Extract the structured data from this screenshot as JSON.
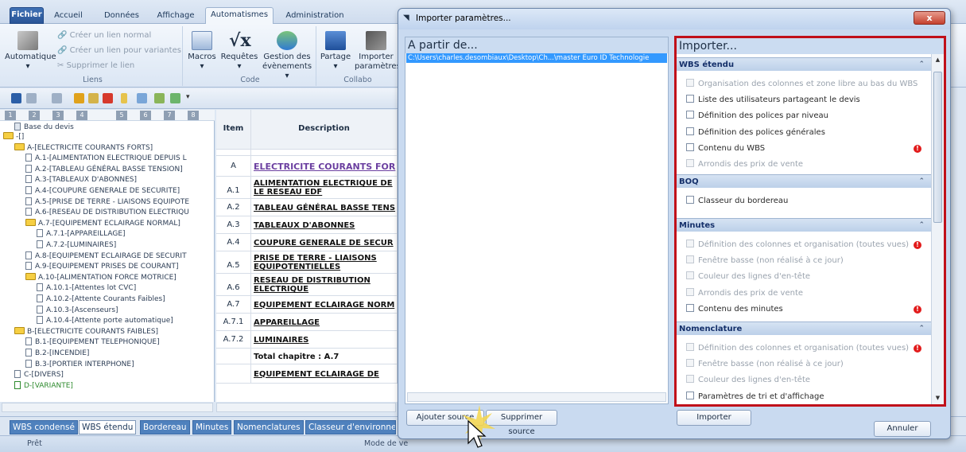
{
  "ribbon": {
    "tabs": [
      "Fichier",
      "Accueil",
      "Données",
      "Affichage",
      "Automatismes",
      "Administration"
    ],
    "active_tab": "Automatismes",
    "liens": {
      "label": "Liens",
      "automatique": "Automatique",
      "creer_normal": "Créer un lien normal",
      "creer_variantes": "Créer un lien pour variantes",
      "supprimer": "Supprimer le lien"
    },
    "code": {
      "label": "Code",
      "macros": "Macros",
      "requetes": "Requêtes",
      "gestion1": "Gestion des",
      "gestion2": "évènements"
    },
    "collab": {
      "label": "Collabo",
      "partage": "Partage",
      "importer1": "Importer",
      "importer2": "paramètres"
    }
  },
  "tree": {
    "levels": [
      "1",
      "2",
      "3",
      "4",
      "5",
      "6",
      "7",
      "8"
    ],
    "root": "Base du devis",
    "nodes": [
      {
        "text": "-[]",
        "indent": 0,
        "type": "folder"
      },
      {
        "text": "A-[ELECTRICITE COURANTS FORTS]",
        "indent": 1,
        "type": "folder"
      },
      {
        "text": "A.1-[ALIMENTATION ELECTRIQUE DEPUIS L",
        "indent": 2,
        "type": "doc"
      },
      {
        "text": "A.2-[TABLEAU GÉNÉRAL BASSE TENSION]",
        "indent": 2,
        "type": "doc"
      },
      {
        "text": "A.3-[TABLEAUX D'ABONNES]",
        "indent": 2,
        "type": "doc"
      },
      {
        "text": "A.4-[COUPURE GENERALE DE SECURITE]",
        "indent": 2,
        "type": "doc"
      },
      {
        "text": "A.5-[PRISE DE TERRE - LIAISONS EQUIPOTE",
        "indent": 2,
        "type": "doc"
      },
      {
        "text": "A.6-[RESEAU DE DISTRIBUTION ELECTRIQU",
        "indent": 2,
        "type": "doc"
      },
      {
        "text": "A.7-[EQUIPEMENT ECLAIRAGE NORMAL]",
        "indent": 2,
        "type": "folder"
      },
      {
        "text": "A.7.1-[APPAREILLAGE]",
        "indent": 3,
        "type": "doc"
      },
      {
        "text": "A.7.2-[LUMINAIRES]",
        "indent": 3,
        "type": "doc"
      },
      {
        "text": "A.8-[EQUIPEMENT ECLAIRAGE DE SECURIT",
        "indent": 2,
        "type": "doc"
      },
      {
        "text": "A.9-[EQUIPEMENT PRISES DE COURANT]",
        "indent": 2,
        "type": "doc"
      },
      {
        "text": "A.10-[ALIMENTATION FORCE MOTRICE]",
        "indent": 2,
        "type": "folder"
      },
      {
        "text": "A.10.1-[Attentes lot CVC]",
        "indent": 3,
        "type": "doc"
      },
      {
        "text": "A.10.2-[Attente Courants Faibles]",
        "indent": 3,
        "type": "doc"
      },
      {
        "text": "A.10.3-[Ascenseurs]",
        "indent": 3,
        "type": "doc"
      },
      {
        "text": "A.10.4-[Attente porte automatique]",
        "indent": 3,
        "type": "doc"
      },
      {
        "text": "B-[ELECTRICITE COURANTS FAIBLES]",
        "indent": 1,
        "type": "folder"
      },
      {
        "text": "B.1-[EQUIPEMENT TELEPHONIQUE]",
        "indent": 2,
        "type": "doc"
      },
      {
        "text": "B.2-[INCENDIE]",
        "indent": 2,
        "type": "doc"
      },
      {
        "text": "B.3-[PORTIER INTERPHONE]",
        "indent": 2,
        "type": "doc"
      },
      {
        "text": "C-[DIVERS]",
        "indent": 1,
        "type": "doc"
      },
      {
        "text": "D-[VARIANTE]",
        "indent": 1,
        "type": "variant"
      }
    ]
  },
  "grid": {
    "col_item": "Item",
    "col_desc": "Description",
    "rows": [
      {
        "item": "",
        "desc": ""
      },
      {
        "item": "A",
        "desc": "ELECTRICITE COURANTS FOR",
        "style": "purple"
      },
      {
        "item": "A.1",
        "desc": "ALIMENTATION ELECTRIQUE DE",
        "desc2": "LE RESEAU EDF"
      },
      {
        "item": "A.2",
        "desc": "TABLEAU GÉNÉRAL BASSE TENS"
      },
      {
        "item": "A.3",
        "desc": "TABLEAUX D'ABONNES"
      },
      {
        "item": "A.4",
        "desc": "COUPURE GENERALE DE SECUR"
      },
      {
        "item": "A.5",
        "desc": "PRISE DE TERRE - LIAISONS",
        "desc2": "EQUIPOTENTIELLES"
      },
      {
        "item": "A.6",
        "desc": "RESEAU DE DISTRIBUTION",
        "desc2": "ELECTRIQUE"
      },
      {
        "item": "A.7",
        "desc": "EQUIPEMENT ECLAIRAGE NORM"
      },
      {
        "item": "A.7.1",
        "desc": "APPAREILLAGE"
      },
      {
        "item": "A.7.2",
        "desc": "LUMINAIRES"
      },
      {
        "item": "",
        "desc": "Total chapitre : A.7",
        "style": "total"
      },
      {
        "item": "",
        "desc": "EQUIPEMENT ECLAIRAGE DE"
      }
    ]
  },
  "sheet_tabs": [
    "WBS condensé",
    "WBS étendu",
    "Bordereau",
    "Minutes",
    "Nomenclatures",
    "Classeur d'environne"
  ],
  "active_sheet_tab": "WBS étendu",
  "status": {
    "left": "Prêt",
    "mode": "Mode de ve"
  },
  "dialog": {
    "title": "Importer paramètres...",
    "close_label": "x",
    "from_header": "A partir de...",
    "source_path": "C:\\Users\\charles.desombiaux\\Desktop\\Ch...\\master Euro ID Technologie",
    "add_source": "Ajouter source",
    "remove_source": "Supprimer source",
    "import_header": "Importer...",
    "import_button": "Importer",
    "cancel_button": "Annuler",
    "sections": [
      {
        "title": "WBS étendu",
        "options": [
          {
            "label": "Organisation des colonnes et zone libre au bas du WBS",
            "enabled": false,
            "warn": false
          },
          {
            "label": "Liste des utilisateurs partageant le devis",
            "enabled": true,
            "warn": false
          },
          {
            "label": "Définition des polices par niveau",
            "enabled": true,
            "warn": false
          },
          {
            "label": "Définition des polices générales",
            "enabled": true,
            "warn": false
          },
          {
            "label": "Contenu du WBS",
            "enabled": true,
            "warn": true
          },
          {
            "label": "Arrondis des prix de vente",
            "enabled": false,
            "warn": false
          }
        ]
      },
      {
        "title": "BOQ",
        "options": [
          {
            "label": "Classeur du bordereau",
            "enabled": true,
            "warn": false
          }
        ]
      },
      {
        "title": "Minutes",
        "options": [
          {
            "label": "Définition des colonnes et organisation (toutes vues)",
            "enabled": false,
            "warn": true
          },
          {
            "label": "Fenêtre basse (non réalisé à ce jour)",
            "enabled": false,
            "warn": false
          },
          {
            "label": "Couleur des lignes d'en-tête",
            "enabled": false,
            "warn": false
          },
          {
            "label": "Arrondis des prix de vente",
            "enabled": false,
            "warn": false
          },
          {
            "label": "Contenu des minutes",
            "enabled": true,
            "warn": true
          }
        ]
      },
      {
        "title": "Nomenclature",
        "options": [
          {
            "label": "Définition des colonnes et organisation (toutes vues)",
            "enabled": false,
            "warn": true
          },
          {
            "label": "Fenêtre basse (non réalisé à ce jour)",
            "enabled": false,
            "warn": false
          },
          {
            "label": "Couleur des lignes d'en-tête",
            "enabled": false,
            "warn": false
          },
          {
            "label": "Paramètres de tri et d'affichage",
            "enabled": true,
            "warn": false
          }
        ]
      }
    ]
  },
  "colors": {
    "accent": "#4f81bd",
    "highlight": "#c0101a",
    "selection": "#3399ff",
    "warning": "#e21b1b"
  }
}
